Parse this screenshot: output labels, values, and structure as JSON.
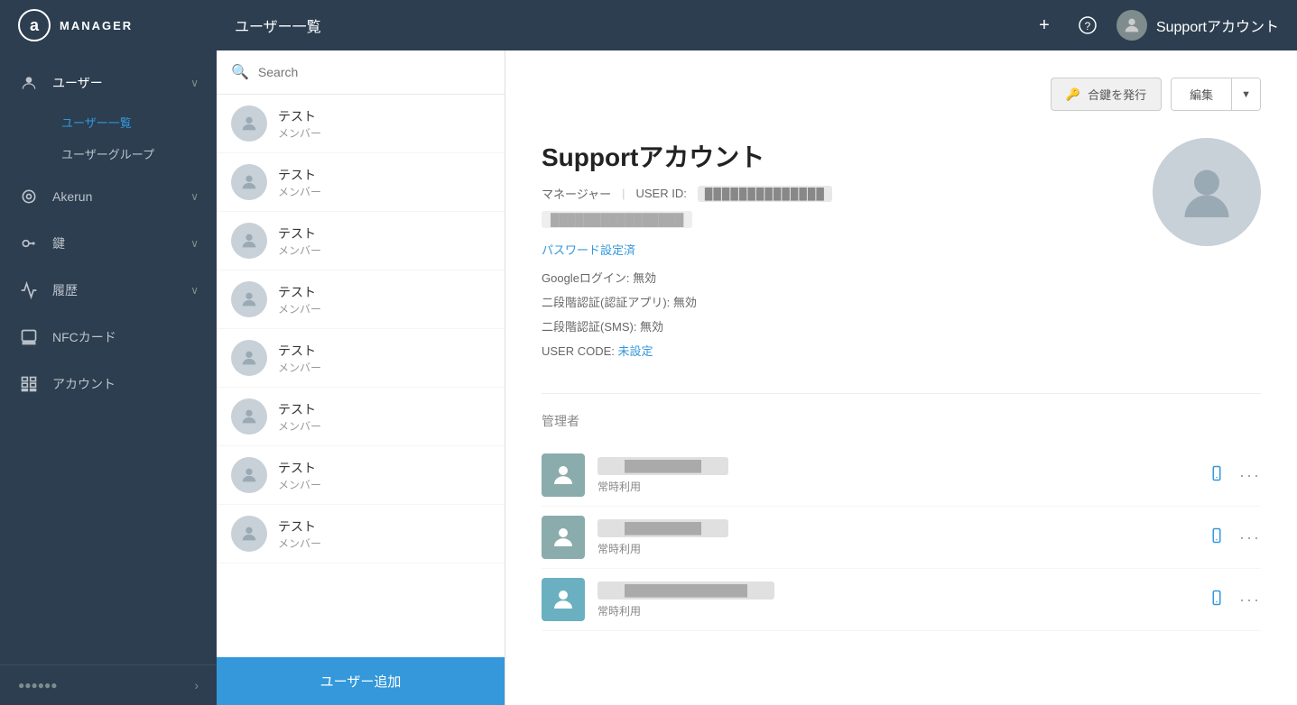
{
  "header": {
    "logo_text": "a",
    "manager_label": "MANAGER",
    "page_title": "ユーザー一覧",
    "add_icon": "+",
    "help_icon": "?",
    "account_name": "Supportアカウント"
  },
  "sidebar": {
    "items": [
      {
        "id": "users",
        "label": "ユーザー",
        "icon": "user",
        "has_chevron": true,
        "active": true
      },
      {
        "id": "akerun",
        "label": "Akerun",
        "icon": "circle",
        "has_chevron": true
      },
      {
        "id": "keys",
        "label": "鍵",
        "icon": "key",
        "has_chevron": true
      },
      {
        "id": "history",
        "label": "履歴",
        "icon": "chart",
        "has_chevron": true
      },
      {
        "id": "nfc",
        "label": "NFCカード",
        "icon": "card"
      },
      {
        "id": "account",
        "label": "アカウント",
        "icon": "table"
      }
    ],
    "sub_items": [
      {
        "id": "user-list",
        "label": "ユーザー一覧",
        "active": true
      },
      {
        "id": "user-groups",
        "label": "ユーザーグループ"
      }
    ],
    "footer_text": "●●●●●●"
  },
  "search": {
    "placeholder": "Search"
  },
  "user_list": {
    "items": [
      {
        "name": "テスト",
        "role": "メンバー"
      },
      {
        "name": "テスト",
        "role": "メンバー"
      },
      {
        "name": "テスト",
        "role": "メンバー"
      },
      {
        "name": "テスト",
        "role": "メンバー"
      },
      {
        "name": "テスト",
        "role": "メンバー"
      },
      {
        "name": "テスト",
        "role": "メンバー"
      },
      {
        "name": "テスト",
        "role": "メンバー"
      },
      {
        "name": "テスト",
        "role": "メンバー"
      }
    ],
    "add_button_label": "ユーザー追加"
  },
  "user_detail": {
    "name": "Supportアカウント",
    "role": "マネージャー",
    "user_id_label": "USER ID:",
    "user_id_value": "██████████████",
    "email_masked": "████████████████",
    "password_status": "パスワード設定済",
    "google_login": "Googleログイン: 無効",
    "two_factor_app": "二段階認証(認証アプリ): 無効",
    "two_factor_sms": "二段階認証(SMS): 無効",
    "user_code_label": "USER CODE:",
    "user_code_value": "未設定",
    "managers_section_title": "管理者",
    "managers": [
      {
        "name_masked": "██████████",
        "usage": "常時利用"
      },
      {
        "name_masked": "██████████",
        "usage": "常時利用"
      },
      {
        "name_masked": "████████████████",
        "usage": "常時利用"
      }
    ]
  },
  "toolbar": {
    "issue_key_label": "合鍵を発行",
    "edit_label": "編集",
    "edit_arrow": "▼"
  },
  "colors": {
    "sidebar_bg": "#2c3e50",
    "accent": "#3498db",
    "active_text": "#3498db"
  }
}
